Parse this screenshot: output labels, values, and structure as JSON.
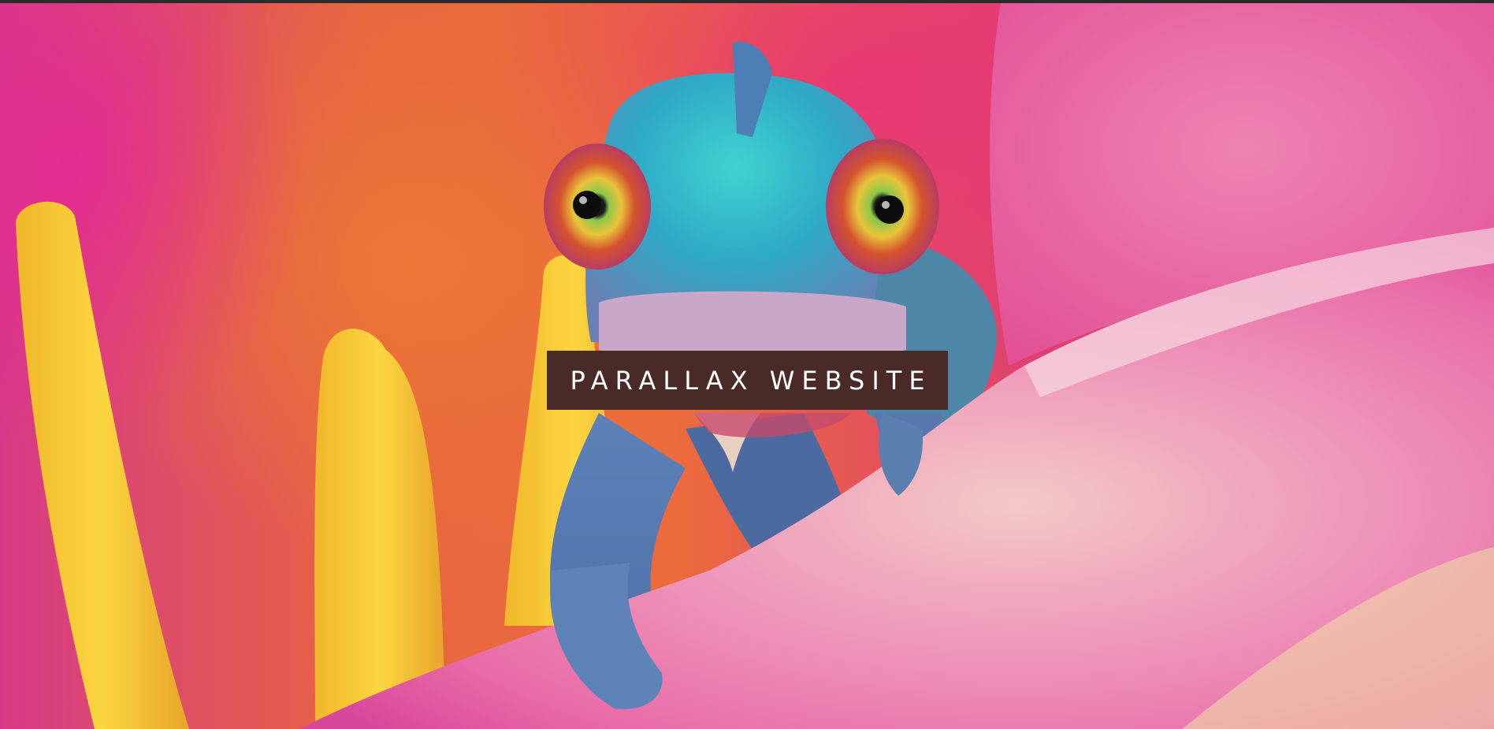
{
  "hero": {
    "title": "PARALLAX WEBSITE",
    "background_image": "chameleon-on-pink-flower-petal",
    "title_box_color": "#4a2a27",
    "title_text_color": "#ffffff"
  }
}
